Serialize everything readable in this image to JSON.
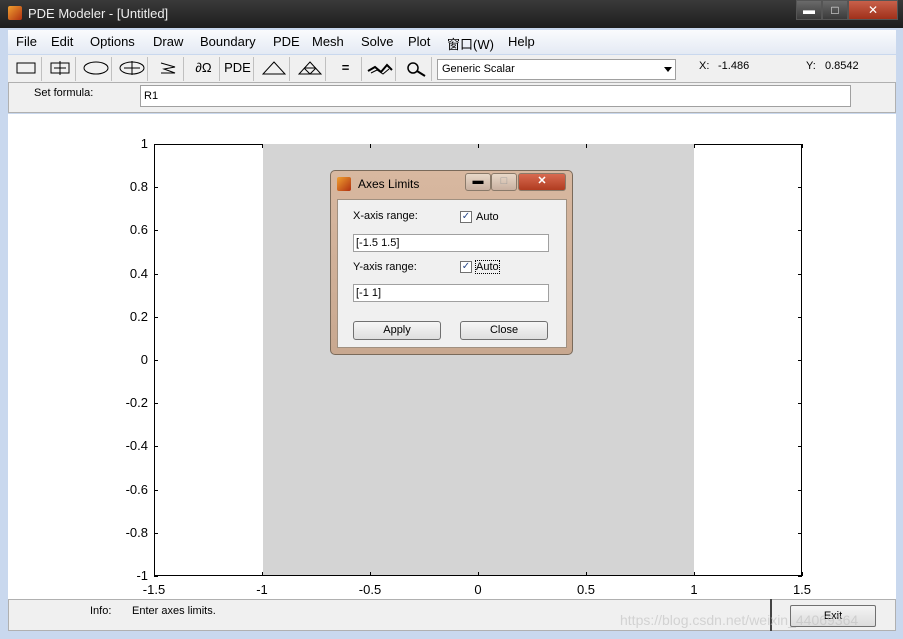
{
  "window": {
    "title": "PDE Modeler - [Untitled]",
    "minimize": "▬",
    "maximize": "□",
    "close": "✕"
  },
  "menu": [
    "File",
    "Edit",
    "Options",
    "Draw",
    "Boundary",
    "PDE",
    "Mesh",
    "Solve",
    "Plot",
    "窗口(W)",
    "Help"
  ],
  "toolbar": {
    "tools": [
      {
        "name": "rectangle-icon"
      },
      {
        "name": "centered-rectangle-icon"
      },
      {
        "name": "ellipse-icon"
      },
      {
        "name": "centered-ellipse-icon"
      },
      {
        "name": "polygon-icon"
      },
      {
        "name": "boundary-mode-icon",
        "label": "∂Ω"
      },
      {
        "name": "pde-spec-icon",
        "label": "PDE"
      },
      {
        "name": "init-mesh-icon"
      },
      {
        "name": "refine-mesh-icon"
      },
      {
        "name": "solve-icon",
        "label": "="
      },
      {
        "name": "plot-icon"
      },
      {
        "name": "zoom-icon"
      }
    ],
    "application": "Generic Scalar",
    "x_readout_label": "X:",
    "x_readout": "-1.486",
    "y_readout_label": "Y:",
    "y_readout": "0.8542"
  },
  "formula": {
    "label": "Set formula:",
    "value": "R1"
  },
  "axes": {
    "yticks": [
      "1",
      "0.8",
      "0.6",
      "0.4",
      "0.2",
      "0",
      "-0.2",
      "-0.4",
      "-0.6",
      "-0.8",
      "-1"
    ],
    "xticks": [
      "-1.5",
      "-1",
      "-0.5",
      "0",
      "0.5",
      "1",
      "1.5"
    ],
    "xlim": [
      -1.5,
      1.5
    ],
    "ylim": [
      -1,
      1
    ]
  },
  "status": {
    "info_label": "Info:",
    "info_text": "Enter axes limits.",
    "exit": "Exit",
    "watermark": "https://blog.csdn.net/weixin_44069364"
  },
  "dialog": {
    "title": "Axes Limits",
    "x_label": "X-axis range:",
    "x_auto_label": "Auto",
    "x_auto_checked": true,
    "x_value": "[-1.5 1.5]",
    "y_label": "Y-axis range:",
    "y_auto_label": "Auto",
    "y_auto_checked": true,
    "y_value": "[-1 1]",
    "apply": "Apply",
    "close": "Close"
  }
}
